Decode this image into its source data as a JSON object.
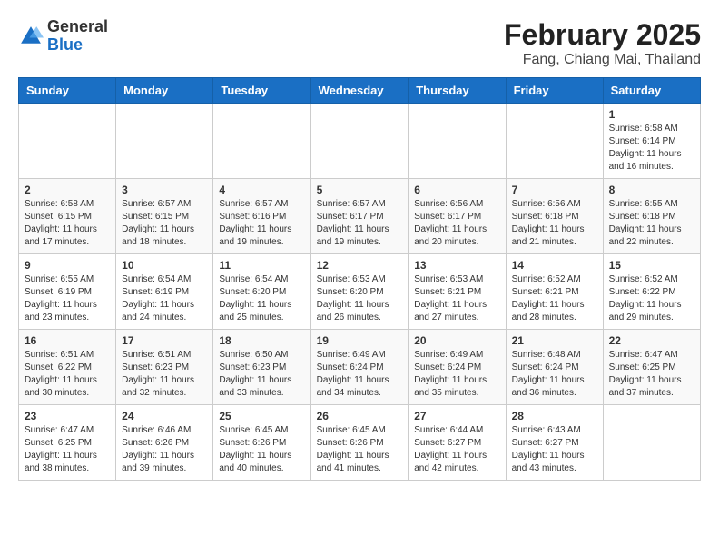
{
  "header": {
    "logo_general": "General",
    "logo_blue": "Blue",
    "month_year": "February 2025",
    "location": "Fang, Chiang Mai, Thailand"
  },
  "days_of_week": [
    "Sunday",
    "Monday",
    "Tuesday",
    "Wednesday",
    "Thursday",
    "Friday",
    "Saturday"
  ],
  "weeks": [
    [
      {
        "day": "",
        "info": ""
      },
      {
        "day": "",
        "info": ""
      },
      {
        "day": "",
        "info": ""
      },
      {
        "day": "",
        "info": ""
      },
      {
        "day": "",
        "info": ""
      },
      {
        "day": "",
        "info": ""
      },
      {
        "day": "1",
        "info": "Sunrise: 6:58 AM\nSunset: 6:14 PM\nDaylight: 11 hours and 16 minutes."
      }
    ],
    [
      {
        "day": "2",
        "info": "Sunrise: 6:58 AM\nSunset: 6:15 PM\nDaylight: 11 hours and 17 minutes."
      },
      {
        "day": "3",
        "info": "Sunrise: 6:57 AM\nSunset: 6:15 PM\nDaylight: 11 hours and 18 minutes."
      },
      {
        "day": "4",
        "info": "Sunrise: 6:57 AM\nSunset: 6:16 PM\nDaylight: 11 hours and 19 minutes."
      },
      {
        "day": "5",
        "info": "Sunrise: 6:57 AM\nSunset: 6:17 PM\nDaylight: 11 hours and 19 minutes."
      },
      {
        "day": "6",
        "info": "Sunrise: 6:56 AM\nSunset: 6:17 PM\nDaylight: 11 hours and 20 minutes."
      },
      {
        "day": "7",
        "info": "Sunrise: 6:56 AM\nSunset: 6:18 PM\nDaylight: 11 hours and 21 minutes."
      },
      {
        "day": "8",
        "info": "Sunrise: 6:55 AM\nSunset: 6:18 PM\nDaylight: 11 hours and 22 minutes."
      }
    ],
    [
      {
        "day": "9",
        "info": "Sunrise: 6:55 AM\nSunset: 6:19 PM\nDaylight: 11 hours and 23 minutes."
      },
      {
        "day": "10",
        "info": "Sunrise: 6:54 AM\nSunset: 6:19 PM\nDaylight: 11 hours and 24 minutes."
      },
      {
        "day": "11",
        "info": "Sunrise: 6:54 AM\nSunset: 6:20 PM\nDaylight: 11 hours and 25 minutes."
      },
      {
        "day": "12",
        "info": "Sunrise: 6:53 AM\nSunset: 6:20 PM\nDaylight: 11 hours and 26 minutes."
      },
      {
        "day": "13",
        "info": "Sunrise: 6:53 AM\nSunset: 6:21 PM\nDaylight: 11 hours and 27 minutes."
      },
      {
        "day": "14",
        "info": "Sunrise: 6:52 AM\nSunset: 6:21 PM\nDaylight: 11 hours and 28 minutes."
      },
      {
        "day": "15",
        "info": "Sunrise: 6:52 AM\nSunset: 6:22 PM\nDaylight: 11 hours and 29 minutes."
      }
    ],
    [
      {
        "day": "16",
        "info": "Sunrise: 6:51 AM\nSunset: 6:22 PM\nDaylight: 11 hours and 30 minutes."
      },
      {
        "day": "17",
        "info": "Sunrise: 6:51 AM\nSunset: 6:23 PM\nDaylight: 11 hours and 32 minutes."
      },
      {
        "day": "18",
        "info": "Sunrise: 6:50 AM\nSunset: 6:23 PM\nDaylight: 11 hours and 33 minutes."
      },
      {
        "day": "19",
        "info": "Sunrise: 6:49 AM\nSunset: 6:24 PM\nDaylight: 11 hours and 34 minutes."
      },
      {
        "day": "20",
        "info": "Sunrise: 6:49 AM\nSunset: 6:24 PM\nDaylight: 11 hours and 35 minutes."
      },
      {
        "day": "21",
        "info": "Sunrise: 6:48 AM\nSunset: 6:24 PM\nDaylight: 11 hours and 36 minutes."
      },
      {
        "day": "22",
        "info": "Sunrise: 6:47 AM\nSunset: 6:25 PM\nDaylight: 11 hours and 37 minutes."
      }
    ],
    [
      {
        "day": "23",
        "info": "Sunrise: 6:47 AM\nSunset: 6:25 PM\nDaylight: 11 hours and 38 minutes."
      },
      {
        "day": "24",
        "info": "Sunrise: 6:46 AM\nSunset: 6:26 PM\nDaylight: 11 hours and 39 minutes."
      },
      {
        "day": "25",
        "info": "Sunrise: 6:45 AM\nSunset: 6:26 PM\nDaylight: 11 hours and 40 minutes."
      },
      {
        "day": "26",
        "info": "Sunrise: 6:45 AM\nSunset: 6:26 PM\nDaylight: 11 hours and 41 minutes."
      },
      {
        "day": "27",
        "info": "Sunrise: 6:44 AM\nSunset: 6:27 PM\nDaylight: 11 hours and 42 minutes."
      },
      {
        "day": "28",
        "info": "Sunrise: 6:43 AM\nSunset: 6:27 PM\nDaylight: 11 hours and 43 minutes."
      },
      {
        "day": "",
        "info": ""
      }
    ]
  ]
}
